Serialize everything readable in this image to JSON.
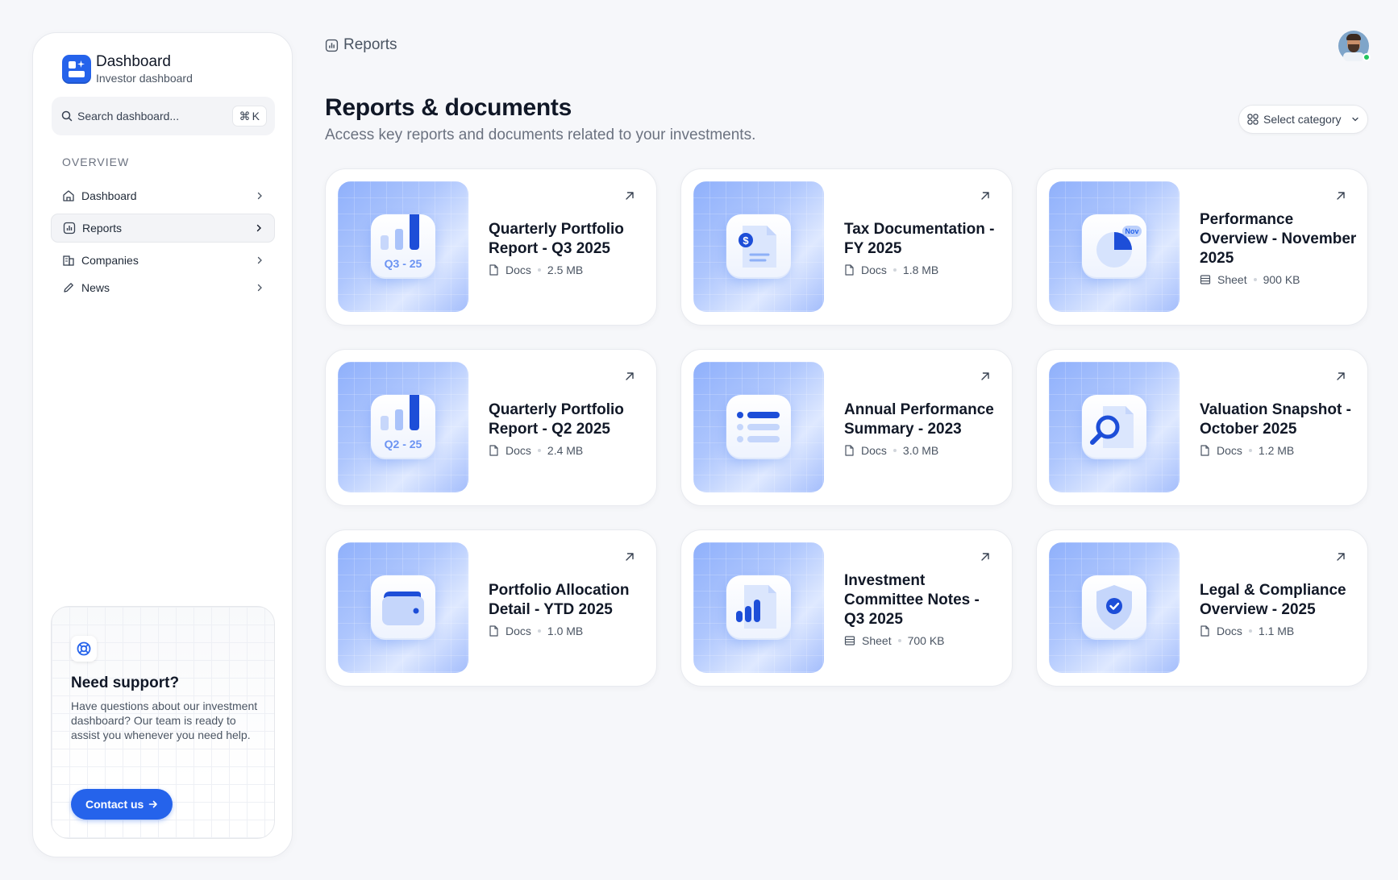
{
  "brand": {
    "title": "Dashboard",
    "subtitle": "Investor dashboard"
  },
  "search": {
    "placeholder": "Search dashboard...",
    "shortcut_symbol": "⌘",
    "shortcut_key": "K"
  },
  "sidebar": {
    "section": "OVERVIEW",
    "items": [
      {
        "label": "Dashboard",
        "icon": "home-icon"
      },
      {
        "label": "Reports",
        "icon": "chart-icon",
        "active": true
      },
      {
        "label": "Companies",
        "icon": "building-icon"
      },
      {
        "label": "News",
        "icon": "pencil-icon"
      }
    ]
  },
  "support": {
    "title": "Need support?",
    "text": "Have questions about our investment dashboard? Our team is ready to assist you whenever you need help.",
    "button": "Contact us"
  },
  "header": {
    "breadcrumb": "Reports"
  },
  "page": {
    "title": "Reports & documents",
    "subtitle": "Access key reports and documents related to your investments.",
    "category_select": "Select category"
  },
  "colors": {
    "accent": "#2563eb",
    "status_online": "#22c55e"
  },
  "cards": [
    {
      "title": "Quarterly Portfolio Report - Q3 2025",
      "type": "Docs",
      "size": "2.5 MB",
      "icon": "bar-chart-q3-icon",
      "badge": "Q3 - 25"
    },
    {
      "title": "Tax Documentation - FY 2025",
      "type": "Docs",
      "size": "1.8 MB",
      "icon": "tax-document-icon"
    },
    {
      "title": "Performance Overview - November 2025",
      "type": "Sheet",
      "size": "900 KB",
      "icon": "pie-chart-icon",
      "badge": "Nov"
    },
    {
      "title": "Quarterly Portfolio Report - Q2 2025",
      "type": "Docs",
      "size": "2.4 MB",
      "icon": "bar-chart-q2-icon",
      "badge": "Q2 - 25"
    },
    {
      "title": "Annual Performance Summary - 2023",
      "type": "Docs",
      "size": "3.0 MB",
      "icon": "list-icon"
    },
    {
      "title": "Valuation Snapshot - October 2025",
      "type": "Docs",
      "size": "1.2 MB",
      "icon": "magnifier-document-icon"
    },
    {
      "title": "Portfolio Allocation Detail - YTD 2025",
      "type": "Docs",
      "size": "1.0 MB",
      "icon": "wallet-icon"
    },
    {
      "title": "Investment Committee Notes - Q3 2025",
      "type": "Sheet",
      "size": "700 KB",
      "icon": "chart-document-icon"
    },
    {
      "title": "Legal & Compliance Overview - 2025",
      "type": "Docs",
      "size": "1.1 MB",
      "icon": "shield-check-icon"
    }
  ]
}
